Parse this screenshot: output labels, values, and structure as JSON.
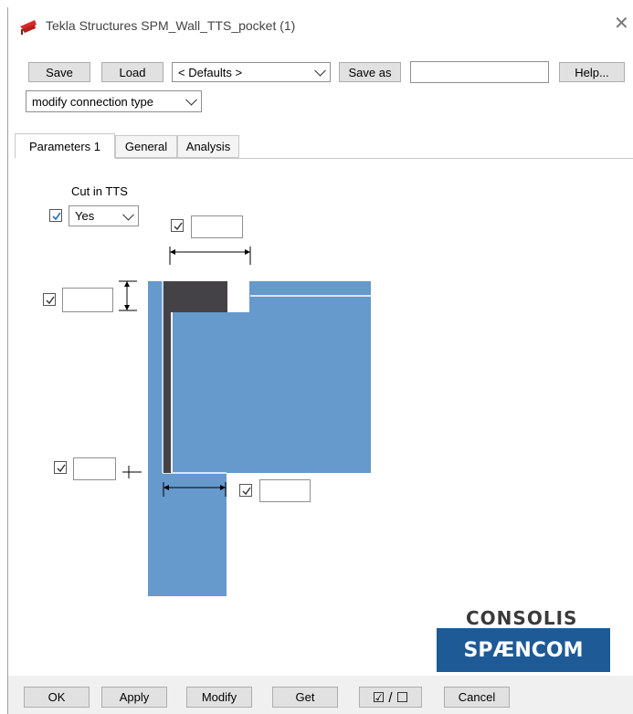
{
  "window": {
    "title": "Tekla Structures  SPM_Wall_TTS_pocket (1)",
    "close_icon": "close-icon"
  },
  "toolbar": {
    "save_label": "Save",
    "load_label": "Load",
    "defaults_value": "< Defaults >",
    "save_as_label": "Save as",
    "save_as_value": "",
    "help_label": "Help...",
    "mode_value": "modify connection type"
  },
  "tabs": [
    {
      "label": "Parameters 1",
      "active": true
    },
    {
      "label": "General",
      "active": false
    },
    {
      "label": "Analysis",
      "active": false
    }
  ],
  "params": {
    "cut_label": "Cut in TTS",
    "cut_value": "Yes",
    "cut_checked": true,
    "top_width_value": "",
    "left_height_value": "",
    "bottom_offset_value": "",
    "bottom_width_value": ""
  },
  "logo": {
    "line1": "CONSOLIS",
    "line2": "SPÆNCOM"
  },
  "footer": {
    "ok_label": "OK",
    "apply_label": "Apply",
    "modify_label": "Modify",
    "get_label": "Get",
    "toggle_label": "☑ / ☐",
    "cancel_label": "Cancel"
  },
  "colors": {
    "panel_blue": "#6699cc",
    "pocket_dark": "#444246",
    "logo_blue": "#1e5a96"
  }
}
